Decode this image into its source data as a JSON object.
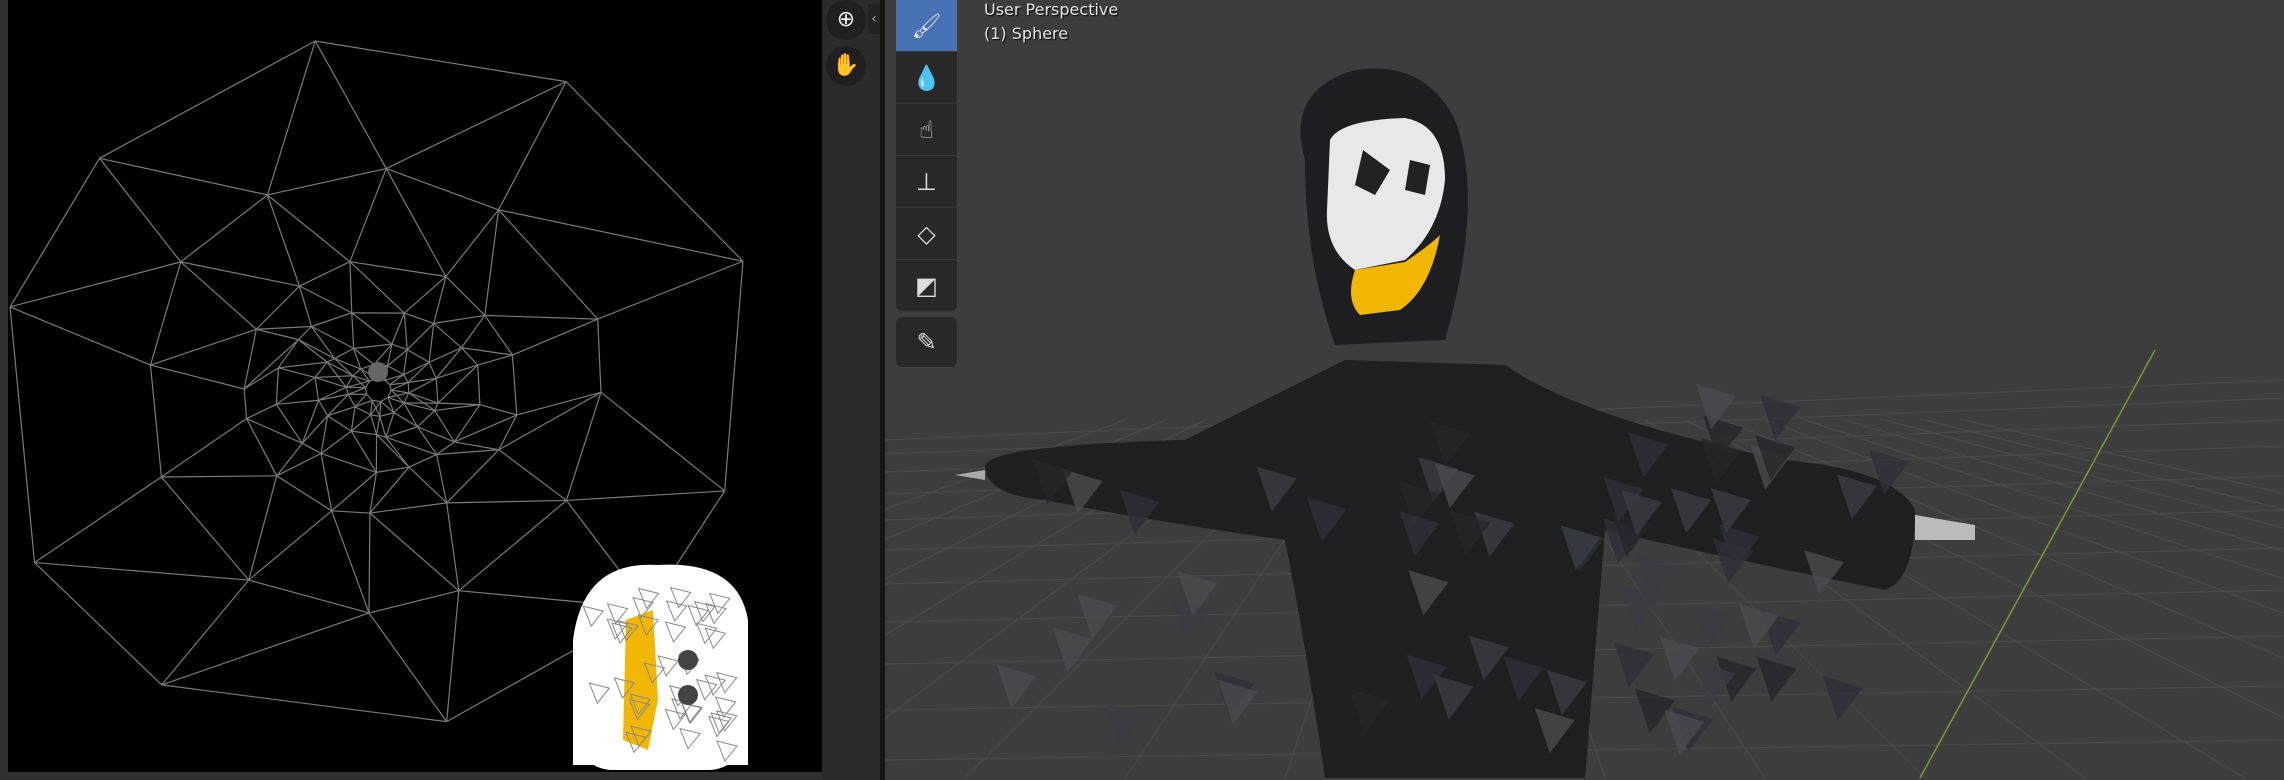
{
  "viewport": {
    "view_name": "User Perspective",
    "object_label": "(1) Sphere"
  },
  "nav_buttons": [
    {
      "icon": "zoom-icon",
      "glyph": "⊕"
    },
    {
      "icon": "hand-pan-icon",
      "glyph": "✋"
    }
  ],
  "collapse_glyph": "‹",
  "toolbar": {
    "tools": [
      {
        "icon": "draw-brush-icon",
        "glyph": "🖌",
        "active": true
      },
      {
        "icon": "soften-icon",
        "glyph": "💧",
        "active": false
      },
      {
        "icon": "smear-icon",
        "glyph": "☝",
        "active": false
      },
      {
        "icon": "clone-stamp-icon",
        "glyph": "⊥",
        "active": false
      },
      {
        "icon": "fill-icon",
        "glyph": "◇",
        "active": false
      },
      {
        "icon": "mask-icon",
        "glyph": "◩",
        "active": false
      }
    ],
    "annotate": {
      "icon": "annotate-pencil-icon",
      "glyph": "✎"
    }
  },
  "colors": {
    "accent": "#4772b3",
    "paint_yellow": "#f2b705",
    "wire": "#7a7a7a",
    "axis_y": "#7d9a2a"
  }
}
